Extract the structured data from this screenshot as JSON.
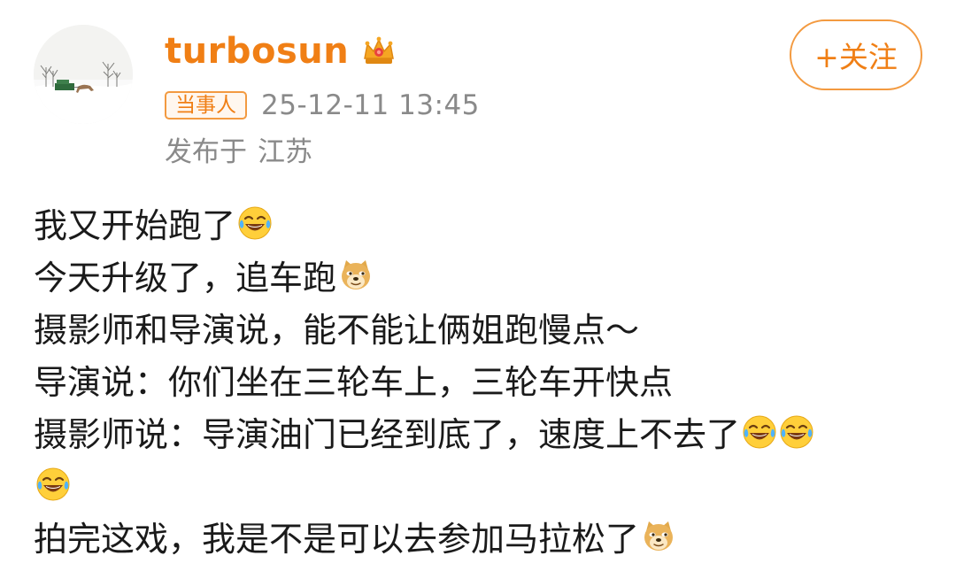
{
  "user": {
    "name": "turbosun",
    "badge": "当事人",
    "time": "25-12-11 13:45",
    "location_label": "发布于",
    "location": "江苏"
  },
  "follow_label": "+关注",
  "colors": {
    "accent": "#f07f15",
    "meta_gray": "#8a8a8a",
    "text": "#1a1a1a"
  },
  "post": {
    "lines": [
      {
        "text": "我又开始跑了",
        "emojis": [
          "laugh-cry"
        ]
      },
      {
        "text": "今天升级了，追车跑",
        "emojis": [
          "doge"
        ]
      },
      {
        "text": "摄影师和导演说，能不能让俩姐跑慢点～",
        "emojis": []
      },
      {
        "text": "导演说：你们坐在三轮车上，三轮车开快点",
        "emojis": []
      },
      {
        "text": "摄影师说：导演油门已经到底了，速度上不去了",
        "emojis": [
          "laugh-cry",
          "laugh-cry"
        ]
      },
      {
        "text": "",
        "emojis": [
          "laugh-cry"
        ]
      },
      {
        "text": "拍完这戏，我是不是可以去参加马拉松了",
        "emojis": [
          "doge"
        ]
      }
    ]
  }
}
